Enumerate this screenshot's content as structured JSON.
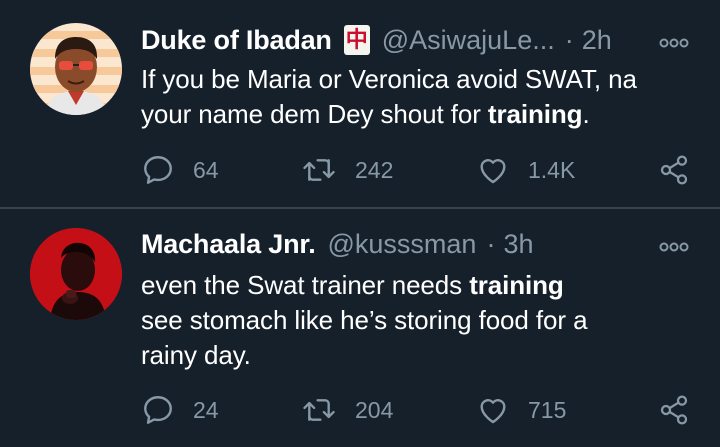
{
  "colors": {
    "background": "#15202b",
    "divider": "#38444d",
    "secondary_text": "#8899a6",
    "primary_text": "#ffffff"
  },
  "tweets": [
    {
      "name": "Duke of Ibadan",
      "name_badge_emoji": "中",
      "name_badge_icon": "mahjong-red-dragon-icon",
      "handle": "@AsiwajuLe...",
      "separator": "·",
      "time": "2h",
      "text_before_bold": "If you be Maria or Veronica avoid SWAT, na your name dem Dey shout for ",
      "text_bold": "training",
      "text_after_bold": ".",
      "reply_count": "64",
      "retweet_count": "242",
      "like_count": "1.4K",
      "avatar_icon": "cartoon-avatar"
    },
    {
      "name": "Machaala Jnr.",
      "handle": "@kusssman",
      "separator": "·",
      "time": "3h",
      "line1_before_bold": "even the Swat trainer needs ",
      "line1_bold": "training",
      "line2": "see stomach like he’s storing food for a rainy day.",
      "reply_count": "24",
      "retweet_count": "204",
      "like_count": "715",
      "avatar_icon": "photo-avatar-red"
    }
  ]
}
